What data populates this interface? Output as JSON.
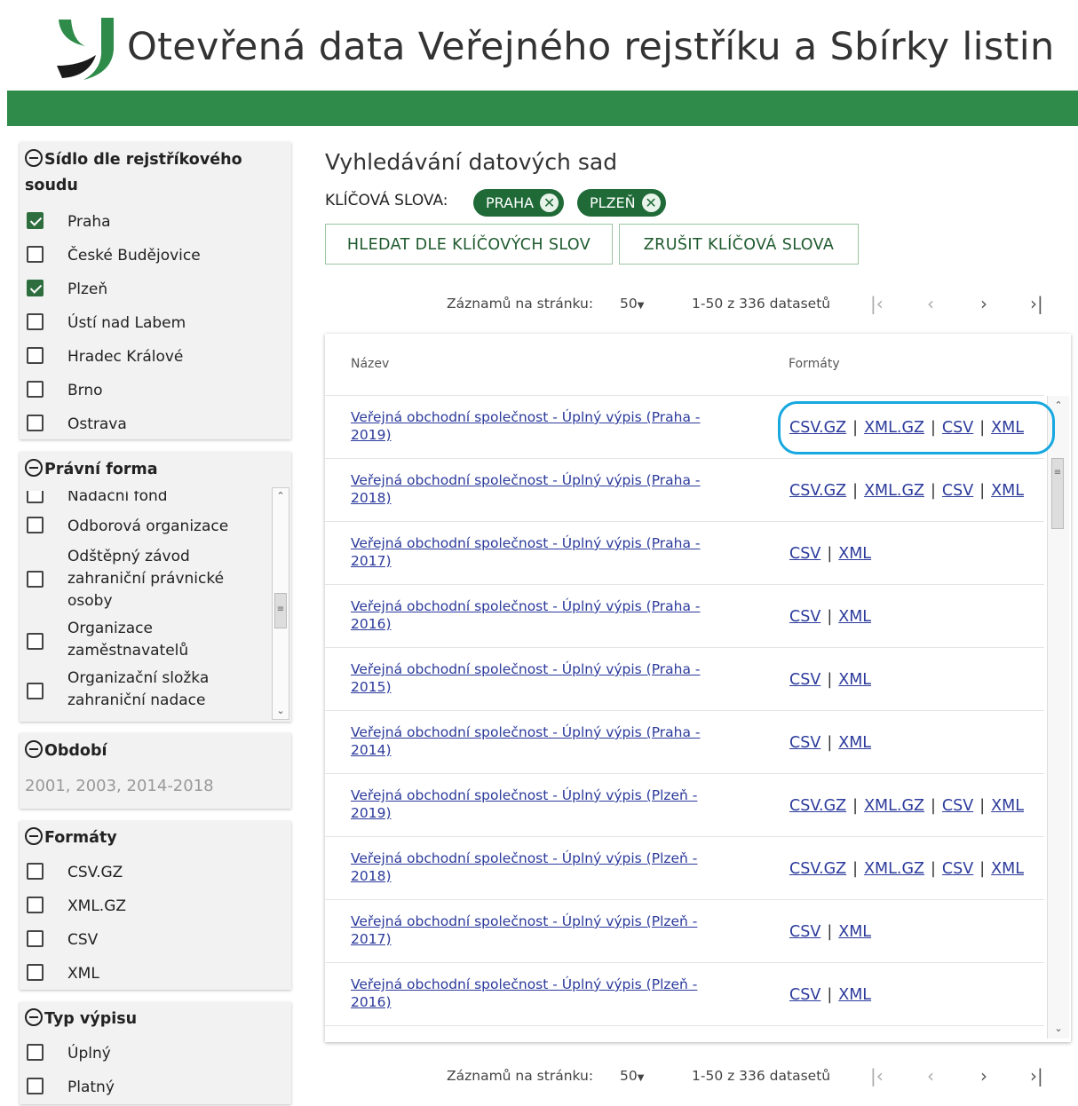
{
  "header": {
    "title": "Otevřená data Veřejného rejstříku a Sbírky listin"
  },
  "colors": {
    "brand_green": "#2e8b49",
    "chip_green": "#1f6a37",
    "link_blue": "#2b3a9b",
    "highlight": "#17a8e0"
  },
  "sidebar": {
    "court": {
      "title": "Sídlo dle rejstříkového soudu",
      "items": [
        {
          "label": "Praha",
          "checked": true
        },
        {
          "label": "České Budějovice",
          "checked": false
        },
        {
          "label": "Plzeň",
          "checked": true
        },
        {
          "label": "Ústí nad Labem",
          "checked": false
        },
        {
          "label": "Hradec Králové",
          "checked": false
        },
        {
          "label": "Brno",
          "checked": false
        },
        {
          "label": "Ostrava",
          "checked": false
        }
      ]
    },
    "legal_form": {
      "title": "Právní forma",
      "items": [
        {
          "label": "Nadační fond"
        },
        {
          "label": "Odborová organizace"
        },
        {
          "label": "Odštěpný závod zahraniční právnické osoby"
        },
        {
          "label": "Organizace zaměstnavatelů"
        },
        {
          "label": "Organizační složka zahraniční nadace"
        }
      ]
    },
    "period": {
      "title": "Období",
      "value": "2001, 2003, 2014-2018"
    },
    "formats": {
      "title": "Formáty",
      "items": [
        {
          "label": "CSV.GZ"
        },
        {
          "label": "XML.GZ"
        },
        {
          "label": "CSV"
        },
        {
          "label": "XML"
        }
      ]
    },
    "extract_type": {
      "title": "Typ výpisu",
      "items": [
        {
          "label": "Úplný"
        },
        {
          "label": "Platný"
        }
      ]
    }
  },
  "main": {
    "title": "Vyhledávání datových sad",
    "keywords_label": "KLÍČOVÁ SLOVA:",
    "keywords": [
      "PRAHA",
      "PLZEŇ"
    ],
    "search_button": "HLEDAT DLE KLÍČOVÝCH SLOV",
    "clear_button": "ZRUŠIT KLÍČOVÁ SLOVA",
    "pager": {
      "per_page_label": "Záznamů na stránku:",
      "per_page": "50",
      "range": "1-50 z 336 datasetů"
    },
    "table": {
      "col_name": "Název",
      "col_formats": "Formáty",
      "rows": [
        {
          "name": "Veřejná obchodní společnost - Úplný výpis (Praha - 2019)",
          "formats": [
            "CSV.GZ",
            "XML.GZ",
            "CSV",
            "XML"
          ]
        },
        {
          "name": "Veřejná obchodní společnost - Úplný výpis (Praha - 2018)",
          "formats": [
            "CSV.GZ",
            "XML.GZ",
            "CSV",
            "XML"
          ]
        },
        {
          "name": "Veřejná obchodní společnost - Úplný výpis (Praha - 2017)",
          "formats": [
            "CSV",
            "XML"
          ]
        },
        {
          "name": "Veřejná obchodní společnost - Úplný výpis (Praha - 2016)",
          "formats": [
            "CSV",
            "XML"
          ]
        },
        {
          "name": "Veřejná obchodní společnost - Úplný výpis (Praha - 2015)",
          "formats": [
            "CSV",
            "XML"
          ]
        },
        {
          "name": "Veřejná obchodní společnost - Úplný výpis (Praha - 2014)",
          "formats": [
            "CSV",
            "XML"
          ]
        },
        {
          "name": "Veřejná obchodní společnost - Úplný výpis (Plzeň - 2019)",
          "formats": [
            "CSV.GZ",
            "XML.GZ",
            "CSV",
            "XML"
          ]
        },
        {
          "name": "Veřejná obchodní společnost - Úplný výpis (Plzeň - 2018)",
          "formats": [
            "CSV.GZ",
            "XML.GZ",
            "CSV",
            "XML"
          ]
        },
        {
          "name": "Veřejná obchodní společnost - Úplný výpis (Plzeň - 2017)",
          "formats": [
            "CSV",
            "XML"
          ]
        },
        {
          "name": "Veřejná obchodní společnost - Úplný výpis (Plzeň - 2016)",
          "formats": [
            "CSV",
            "XML"
          ]
        }
      ]
    }
  }
}
